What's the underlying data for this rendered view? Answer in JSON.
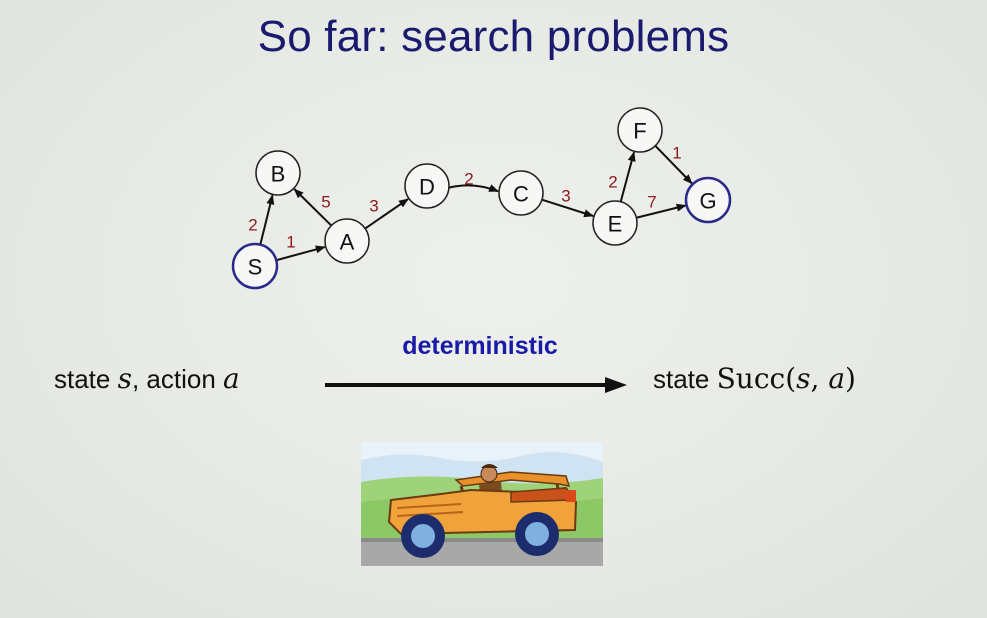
{
  "title": "So far: search problems",
  "graph": {
    "nodes": [
      {
        "id": "S",
        "label": "S",
        "highlight": true
      },
      {
        "id": "B",
        "label": "B",
        "highlight": false
      },
      {
        "id": "A",
        "label": "A",
        "highlight": false
      },
      {
        "id": "D",
        "label": "D",
        "highlight": false
      },
      {
        "id": "C",
        "label": "C",
        "highlight": false
      },
      {
        "id": "E",
        "label": "E",
        "highlight": false
      },
      {
        "id": "F",
        "label": "F",
        "highlight": false
      },
      {
        "id": "G",
        "label": "G",
        "highlight": true
      }
    ],
    "edges": [
      {
        "from": "S",
        "to": "B",
        "cost": "2"
      },
      {
        "from": "S",
        "to": "A",
        "cost": "1"
      },
      {
        "from": "A",
        "to": "B",
        "cost": "5"
      },
      {
        "from": "A",
        "to": "D",
        "cost": "3"
      },
      {
        "from": "D",
        "to": "C",
        "cost": "2"
      },
      {
        "from": "C",
        "to": "E",
        "cost": "3"
      },
      {
        "from": "E",
        "to": "F",
        "cost": "2"
      },
      {
        "from": "E",
        "to": "G",
        "cost": "7"
      },
      {
        "from": "F",
        "to": "G",
        "cost": "1"
      }
    ]
  },
  "transition": {
    "lhs_state": "state",
    "lhs_s": "s",
    "lhs_comma": ", action",
    "lhs_a": "a",
    "arrow_label": "deterministic",
    "rhs_state": "state",
    "rhs_succ": "Succ",
    "rhs_args_open": "(",
    "rhs_s": "s",
    "rhs_comma": ", ",
    "rhs_a": "a",
    "rhs_args_close": ")"
  },
  "colors": {
    "title": "#1a1a6e",
    "edge_cost": "#8b1a1a",
    "highlight_node": "#2a2a8a",
    "arrow_label": "#1a1aa8"
  }
}
